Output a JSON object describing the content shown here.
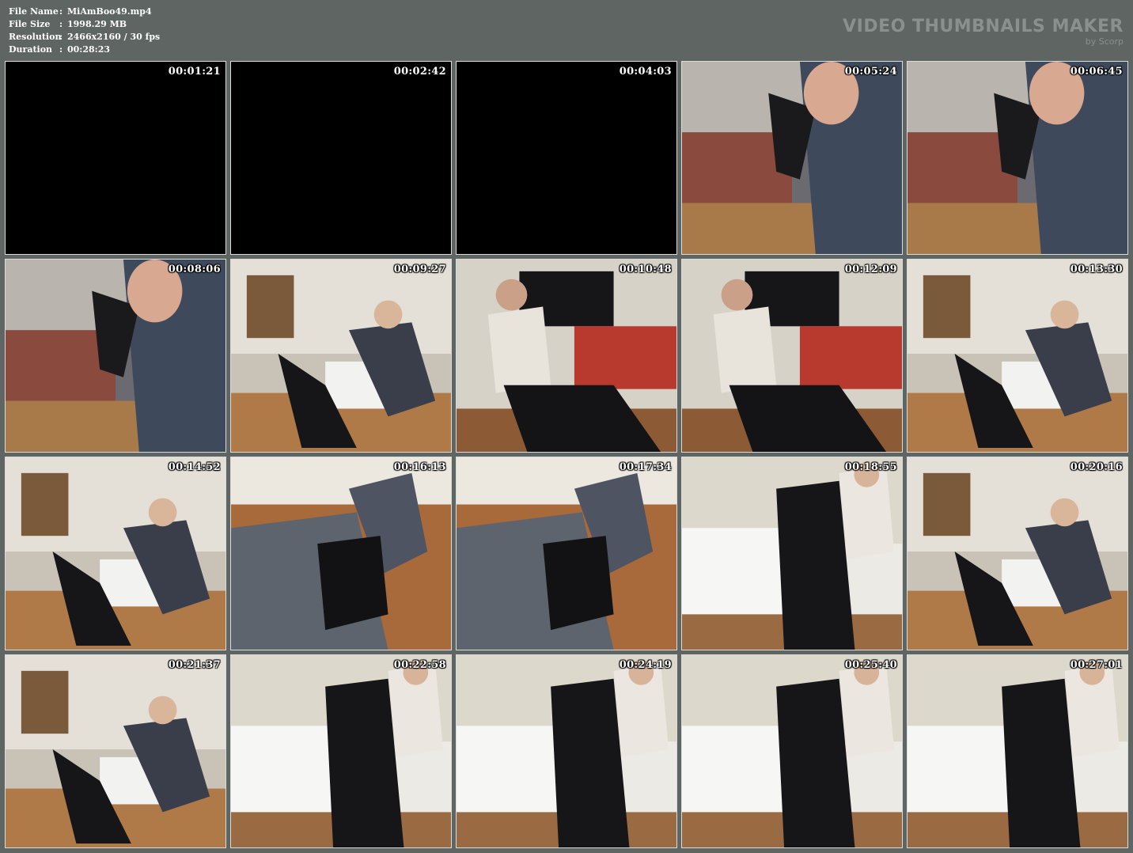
{
  "file_info": {
    "name_label": "File Name",
    "name_value": "MiAmBoo49.mp4",
    "size_label": "File Size",
    "size_value": "1998.29 MB",
    "resolution_label": "Resolution",
    "resolution_value": "2466x2160 / 30 fps",
    "duration_label": "Duration",
    "duration_value": "00:28:23",
    "separator": ":"
  },
  "brand": {
    "title": "VIDEO THUMBNAILS MAKER",
    "subtitle": "by Scorp"
  },
  "thumbnails": [
    {
      "time": "00:01:21",
      "scene": "black"
    },
    {
      "time": "00:02:42",
      "scene": "black"
    },
    {
      "time": "00:04:03",
      "scene": "black"
    },
    {
      "time": "00:05:24",
      "scene": "closeup"
    },
    {
      "time": "00:06:45",
      "scene": "closeup"
    },
    {
      "time": "00:08:06",
      "scene": "closeup"
    },
    {
      "time": "00:09:27",
      "scene": "room"
    },
    {
      "time": "00:10:48",
      "scene": "room-tv"
    },
    {
      "time": "00:12:09",
      "scene": "room-tv"
    },
    {
      "time": "00:13:30",
      "scene": "room"
    },
    {
      "time": "00:14:52",
      "scene": "room"
    },
    {
      "time": "00:16:13",
      "scene": "floor"
    },
    {
      "time": "00:17:34",
      "scene": "floor"
    },
    {
      "time": "00:18:55",
      "scene": "bright"
    },
    {
      "time": "00:20:16",
      "scene": "room"
    },
    {
      "time": "00:21:37",
      "scene": "room"
    },
    {
      "time": "00:22:58",
      "scene": "bright"
    },
    {
      "time": "00:24:19",
      "scene": "bright"
    },
    {
      "time": "00:25:40",
      "scene": "bright"
    },
    {
      "time": "00:27:01",
      "scene": "bright"
    }
  ]
}
